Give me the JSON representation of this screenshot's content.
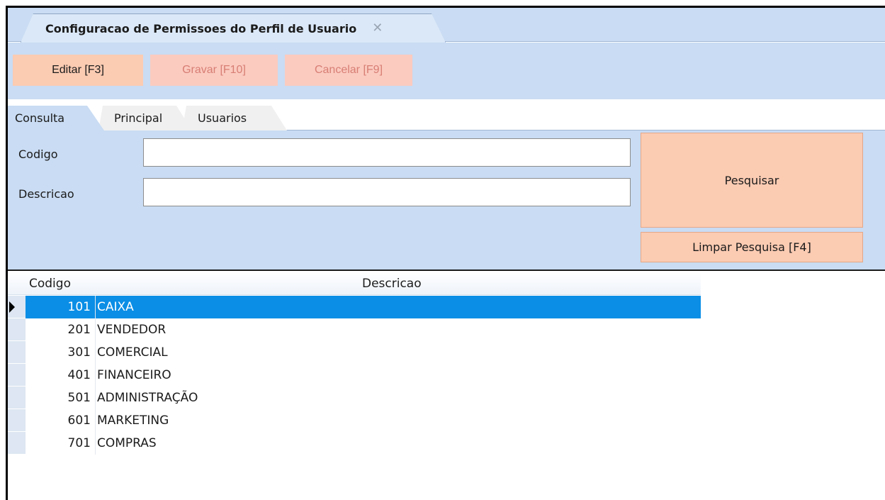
{
  "document_tab": {
    "title": "Configuracao de Permissoes do Perfil de Usuario",
    "close_icon": "✕"
  },
  "toolbar": {
    "edit_label": "Editar [F3]",
    "save_label": "Gravar [F10]",
    "cancel_label": "Cancelar [F9]"
  },
  "page_tabs": {
    "consulta": "Consulta",
    "principal": "Principal",
    "usuarios": "Usuarios"
  },
  "search": {
    "codigo_label": "Codigo",
    "descricao_label": "Descricao",
    "codigo_value": "",
    "descricao_value": "",
    "search_button": "Pesquisar",
    "clear_button": "Limpar Pesquisa [F4]"
  },
  "grid": {
    "columns": [
      "Codigo",
      "Descricao"
    ],
    "rows": [
      {
        "codigo": "101",
        "descricao": "CAIXA",
        "selected": true
      },
      {
        "codigo": "201",
        "descricao": "VENDEDOR",
        "selected": false
      },
      {
        "codigo": "301",
        "descricao": "COMERCIAL",
        "selected": false
      },
      {
        "codigo": "401",
        "descricao": "FINANCEIRO",
        "selected": false
      },
      {
        "codigo": "501",
        "descricao": "ADMINISTRAÇÃO",
        "selected": false
      },
      {
        "codigo": "601",
        "descricao": "MARKETING",
        "selected": false
      },
      {
        "codigo": "701",
        "descricao": "COMPRAS",
        "selected": false
      }
    ]
  },
  "colors": {
    "panel_blue": "#c9dcf3",
    "button_salmon": "#fbcbb2",
    "selection_blue": "#0a8ee6"
  }
}
